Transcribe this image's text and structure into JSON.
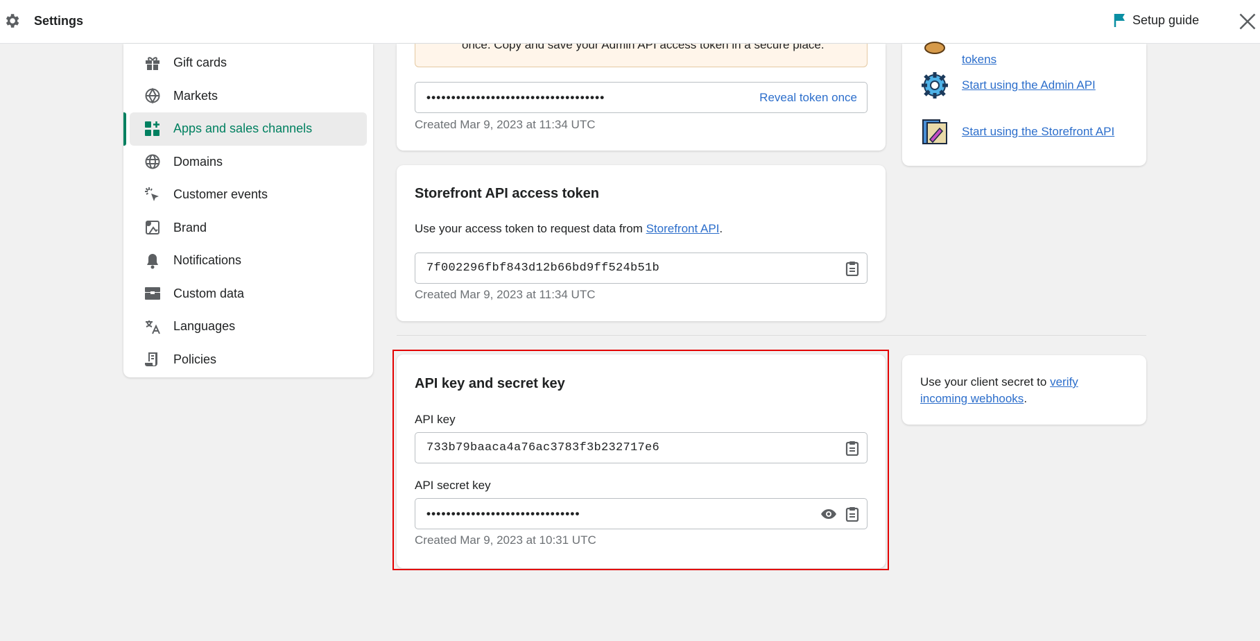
{
  "header": {
    "title": "Settings",
    "setup_guide": "Setup guide"
  },
  "sidebar": {
    "items": [
      {
        "label": "Gift cards",
        "icon": "gift-icon"
      },
      {
        "label": "Markets",
        "icon": "globe-icon"
      },
      {
        "label": "Apps and sales channels",
        "icon": "apps-icon",
        "active": true
      },
      {
        "label": "Domains",
        "icon": "domain-globe-icon"
      },
      {
        "label": "Customer events",
        "icon": "cursor-click-icon"
      },
      {
        "label": "Brand",
        "icon": "brand-icon"
      },
      {
        "label": "Notifications",
        "icon": "bell-icon"
      },
      {
        "label": "Custom data",
        "icon": "custom-data-icon"
      },
      {
        "label": "Languages",
        "icon": "language-icon"
      },
      {
        "label": "Policies",
        "icon": "policy-icon"
      }
    ]
  },
  "admin_token": {
    "banner_text": "once. Copy and save your Admin API access token in a secure place.",
    "masked_value": "••••••••••••••••••••••••••••••••••••",
    "reveal_label": "Reveal token once",
    "created": "Created Mar 9, 2023 at 11:34 UTC"
  },
  "storefront": {
    "title": "Storefront API access token",
    "desc_prefix": "Use your access token to request data from ",
    "desc_link": "Storefront API",
    "desc_suffix": ".",
    "token": "7f002296fbf843d12b66bd9ff524b51b",
    "created": "Created Mar 9, 2023 at 11:34 UTC"
  },
  "api_keys": {
    "title": "API key and secret key",
    "api_key_label": "API key",
    "api_key": "733b79baaca4a76ac3783f3b232717e6",
    "secret_label": "API secret key",
    "secret_masked": "•••••••••••••••••••••••••••••••",
    "created": "Created Mar 9, 2023 at 10:31 UTC"
  },
  "resources": {
    "items": [
      {
        "label": "tokens",
        "icon": "tokens-icon"
      },
      {
        "label": "Start using the Admin API",
        "icon": "admin-api-icon"
      },
      {
        "label": "Start using the Storefront API",
        "icon": "storefront-api-icon"
      }
    ]
  },
  "webhooks": {
    "prefix": "Use your client secret to ",
    "link": "verify incoming webhooks",
    "suffix": "."
  },
  "colors": {
    "accent": "#008060",
    "link": "#2c6ecb",
    "highlight": "#e30000"
  }
}
